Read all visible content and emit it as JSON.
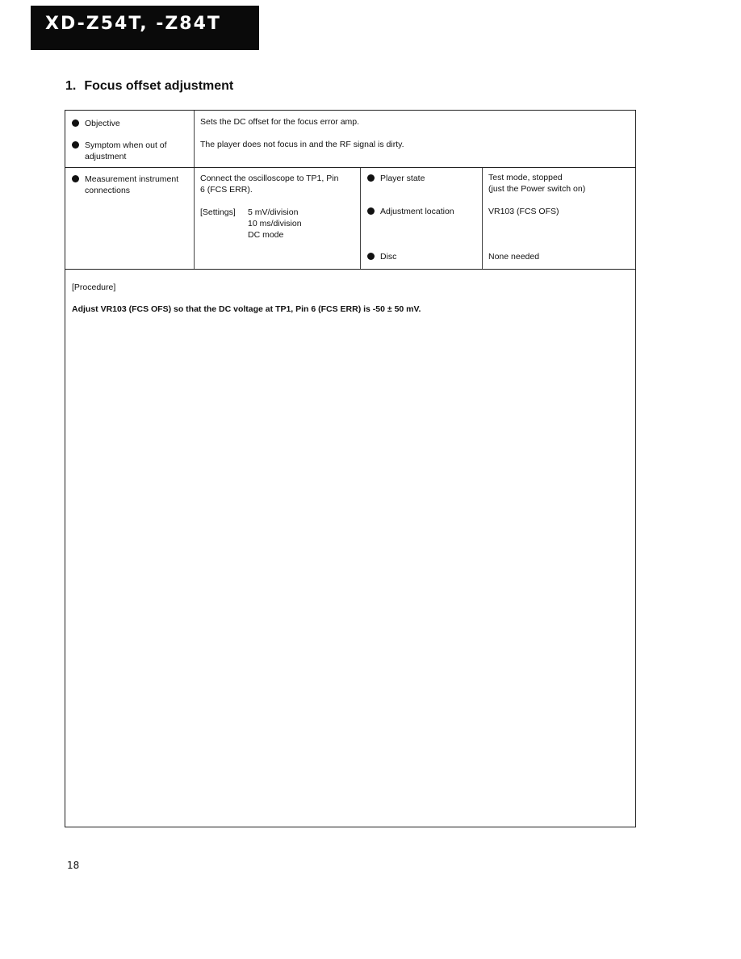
{
  "header": {
    "model_title": "XD-Z54T, -Z84T"
  },
  "section": {
    "number": "1.",
    "title": "Focus offset adjustment"
  },
  "table": {
    "objective": {
      "label": "Objective",
      "value": "Sets the DC offset for the focus error amp."
    },
    "symptom": {
      "label_line1": "Symptom when out of",
      "label_line2": "adjustment",
      "value": "The player does not focus in and the RF signal is dirty."
    },
    "measurement": {
      "label_line1": "Measurement instrument",
      "label_line2": "connections",
      "connect_line1": "Connect the oscilloscope to TP1, Pin",
      "connect_line2": "6 (FCS ERR).",
      "settings_label": "[Settings]",
      "settings": [
        "5 mV/division",
        "10 ms/division",
        "DC mode"
      ]
    },
    "player_state": {
      "label": "Player state",
      "value_line1": "Test mode, stopped",
      "value_line2": "(just the Power switch on)"
    },
    "adjustment_location": {
      "label": "Adjustment location",
      "value": "VR103 (FCS OFS)"
    },
    "disc": {
      "label": "Disc",
      "value": "None needed"
    }
  },
  "procedure": {
    "heading": "[Procedure]",
    "text": "Adjust VR103 (FCS OFS) so that the DC voltage at TP1, Pin 6 (FCS ERR) is -50 ± 50 mV."
  },
  "footer": {
    "page_number": "18"
  }
}
